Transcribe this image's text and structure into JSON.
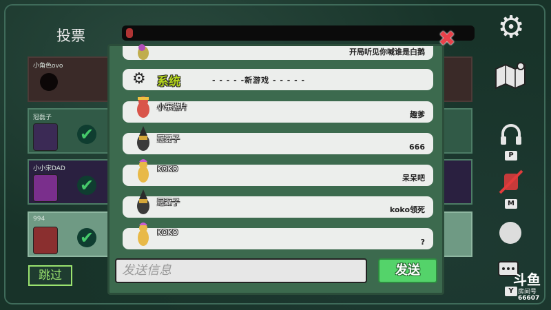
{
  "header": {
    "title": "投票"
  },
  "vote_list": [
    {
      "name": "小角色ovo",
      "state": "dead"
    },
    {
      "name": "冠磊子",
      "state": "voted"
    },
    {
      "name": "小小宋DAD",
      "state": "voted"
    },
    {
      "name": "994",
      "state": "voted"
    }
  ],
  "skip_label": "跳过",
  "sidebar": {
    "settings_icon": "gear-icon",
    "map_icon": "map-icon",
    "voice_key": "P",
    "mute_key": "M",
    "chat_key": "Y",
    "logo_text": "斗鱼",
    "room_label": "房间号",
    "room_number": "66607"
  },
  "chat": {
    "messages": [
      {
        "type": "user",
        "sender": "",
        "text": "开局听见你喊谁是白鹅",
        "avatar_color": "#c0ad4d"
      },
      {
        "type": "system",
        "label": "系统",
        "text": "- - - - -新游戏 - - - - -"
      },
      {
        "type": "user",
        "sender": "小乐游片",
        "text": "趣爹",
        "avatar_color": "#d9554a"
      },
      {
        "type": "user",
        "sender": "冠磊子",
        "text": "666",
        "avatar_color": "#3a3a3a"
      },
      {
        "type": "user",
        "sender": "KOKO",
        "text": "呆呆吧",
        "avatar_color": "#e8b948"
      },
      {
        "type": "user",
        "sender": "冠磊子",
        "text": "koko领死",
        "avatar_color": "#3a3a3a"
      },
      {
        "type": "user",
        "sender": "KOKO",
        "text": "?",
        "avatar_color": "#e8b948"
      }
    ],
    "input_placeholder": "发送信息",
    "send_label": "发送"
  },
  "colors": {
    "accent_green": "#54d36a",
    "system_label": "#b6d61c",
    "close_red": "#e8414a"
  }
}
